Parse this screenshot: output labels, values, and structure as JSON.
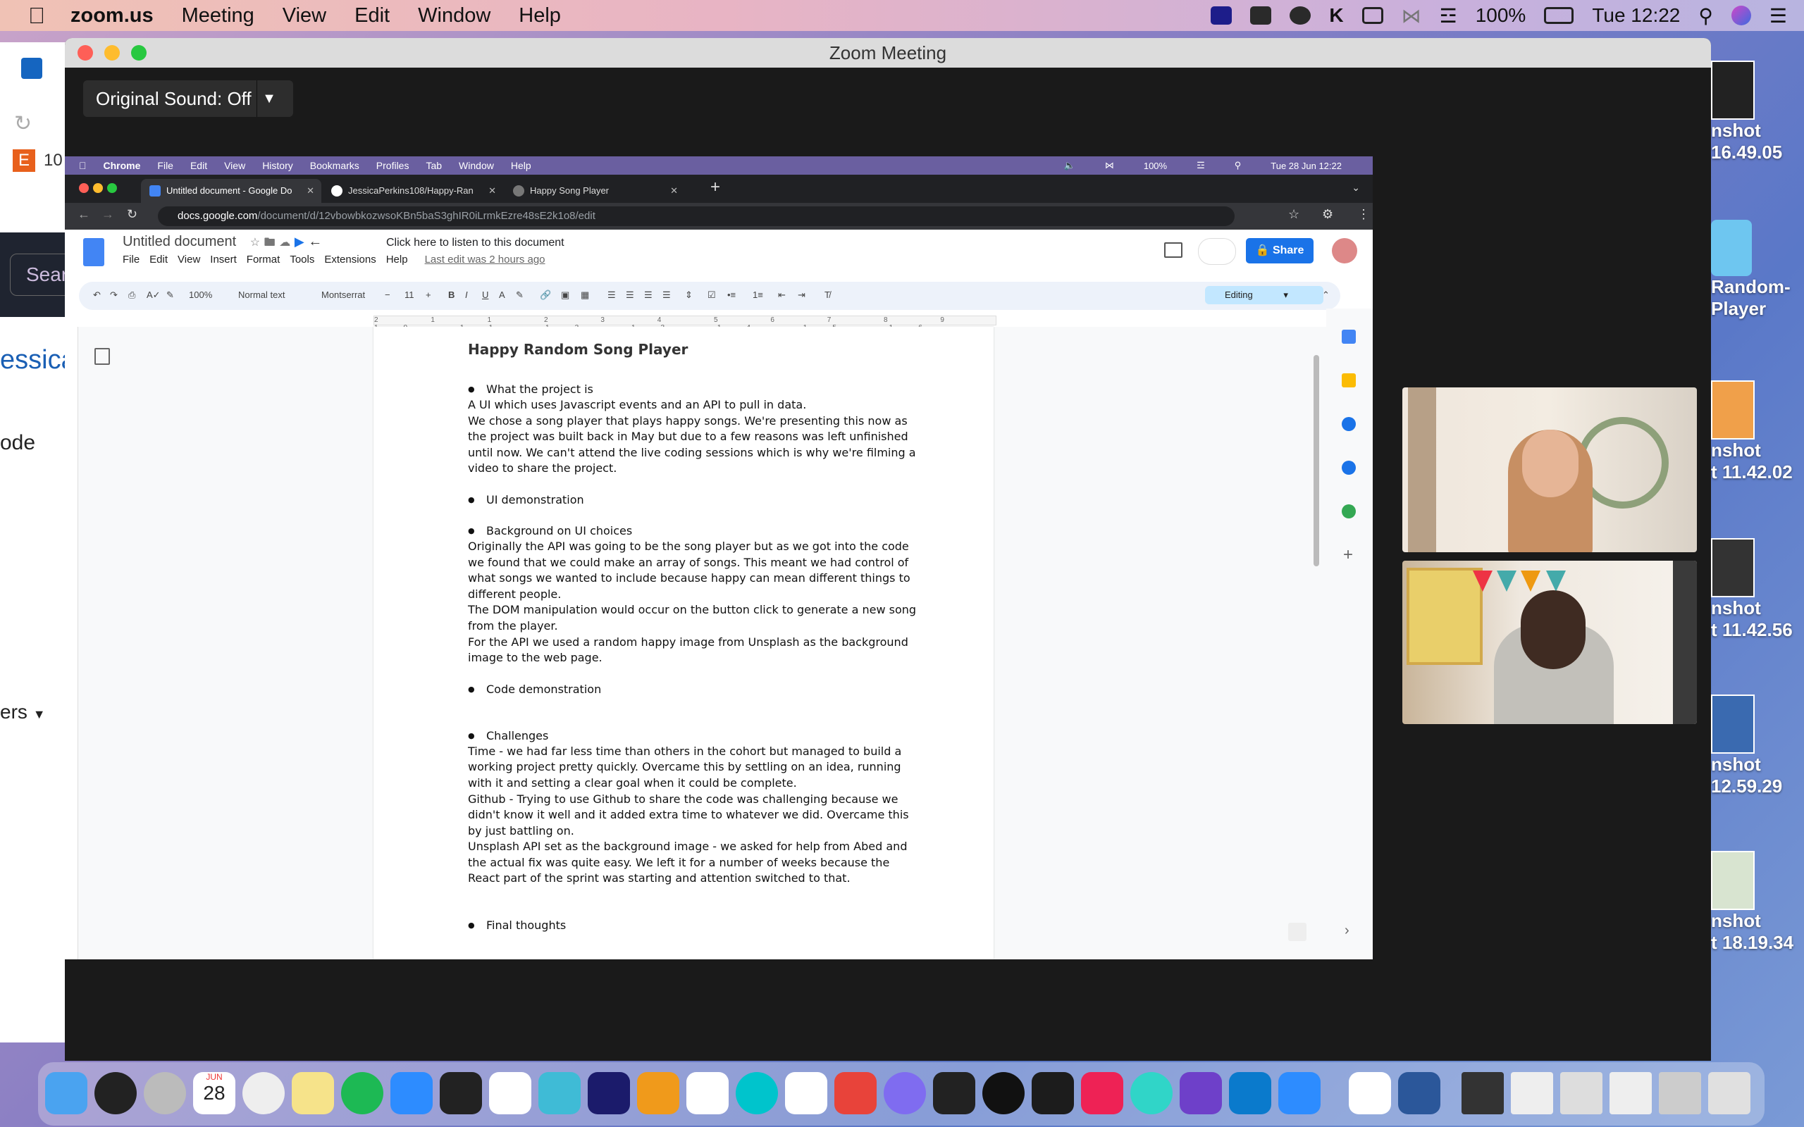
{
  "menubar": {
    "app": "zoom.us",
    "items": [
      "Meeting",
      "View",
      "Edit",
      "Window",
      "Help"
    ],
    "battery": "100%",
    "clock": "Tue 12:22"
  },
  "bgapp": {
    "search": "Sear",
    "name": "essica",
    "code": "ode",
    "filter": "ers",
    "tab_num": "10"
  },
  "desktop": [
    {
      "line1": "nshot",
      "line2": "16.49.05"
    },
    {
      "line1": "Random-",
      "line2": "Player"
    },
    {
      "line1": "nshot",
      "line2": "t 11.42.02"
    },
    {
      "line1": "nshot",
      "line2": "t 11.42.56"
    },
    {
      "line1": "nshot",
      "line2": "12.59.29"
    },
    {
      "line1": "nshot",
      "line2": "t 18.19.34"
    }
  ],
  "zoom": {
    "title": "Zoom Meeting",
    "original_sound": "Original Sound: Off"
  },
  "inner_menubar": {
    "items": [
      "Chrome",
      "File",
      "Edit",
      "View",
      "History",
      "Bookmarks",
      "Profiles",
      "Tab",
      "Window",
      "Help"
    ],
    "battery": "100%",
    "clock": "Tue 28 Jun  12:22"
  },
  "tabs": [
    {
      "label": "Untitled document - Google Do"
    },
    {
      "label": "JessicaPerkins108/Happy-Ran"
    },
    {
      "label": "Happy Song Player"
    }
  ],
  "url": {
    "host": "docs.google.com",
    "path": "/document/d/12vbowbkozwsoKBn5baS3ghIR0iLrmkEzre48sE2k1o8/edit"
  },
  "docs": {
    "title": "Untitled document",
    "listen": "Click here to listen to this document",
    "menu": [
      "File",
      "Edit",
      "View",
      "Insert",
      "Format",
      "Tools",
      "Extensions",
      "Help"
    ],
    "last_edit": "Last edit was 2 hours ago",
    "share": "Share",
    "zoom": "100%",
    "style": "Normal text",
    "font": "Montserrat",
    "size": "11",
    "mode": "Editing",
    "ruler": "2 1 1 2 3 4 5 6 7 8 9 10 11 12 13 14 15 16 17 18"
  },
  "document": {
    "heading": "Happy Random Song Player",
    "b1": "What the project is",
    "p1a": "A UI which uses Javascript events and an API to pull in data.",
    "p1b": "We chose a song player that plays happy songs. We're presenting this now as the project was built back in May but due to a few reasons was left unfinished until now. We can't attend the live coding sessions which is why we're filming a video to share the project.",
    "b2": "UI demonstration",
    "b3": "Background on UI choices",
    "p3a": "Originally the API was going to be the song player but as we got into the code we found that we could make an array of songs. This meant we had control of what songs we wanted to include because happy can mean different things to different people.",
    "p3b": "The DOM manipulation would occur on the button click to generate a new song from the player.",
    "p3c": "For the API we used a random happy image from Unsplash as the background image to the web page.",
    "b4": "Code demonstration",
    "b5": "Challenges",
    "p5a": "Time - we had far less time than others in the cohort but managed to build a working project pretty quickly. Overcame this by settling on an idea, running with it and setting a clear goal when it could be complete.",
    "p5b": "Github - Trying to use Github to share the code was challenging because we didn't know it well and it added extra time to whatever we did. Overcame this by just battling on.",
    "p5c": "Unsplash API set as the background image - we asked for help from Abed and the actual fix was quite easy. We left it for a number of weeks because the React part of the sprint was starting and attention switched to that.",
    "b6": "Final thoughts"
  },
  "dock_calendar": {
    "month": "JUN",
    "day": "28"
  }
}
